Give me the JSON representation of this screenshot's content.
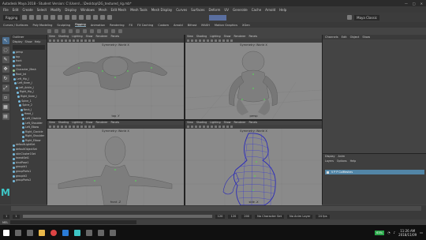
{
  "window": {
    "title": "Autodesk Maya 2018 - Student Version: C:\\Users\\...\\Desktop\\DG_textured_rig.mb*"
  },
  "menubar": [
    "File",
    "Edit",
    "Create",
    "Select",
    "Modify",
    "Display",
    "Windows",
    "Mesh",
    "Edit Mesh",
    "Mesh Tools",
    "Mesh Display",
    "Curves",
    "Surfaces",
    "Deform",
    "UV",
    "Generate",
    "Cache",
    "Arnold",
    "Help"
  ],
  "shelf": {
    "mode": "Rigging",
    "workspace": "Maya Classic"
  },
  "shelf_tabs": [
    "Curves / Surfaces",
    "Poly Modeling",
    "Sculpting",
    "Rigging",
    "Animation",
    "Rendering",
    "FX",
    "FX Caching",
    "Custom",
    "Arnold",
    "Bifrost",
    "MASH",
    "Motion Graphics",
    "XGen"
  ],
  "shelf_tabs_active": "Rigging",
  "outliner": {
    "header": "Outliner",
    "menu": [
      "Display",
      "Show",
      "Help"
    ],
    "items": [
      {
        "label": "persp",
        "type": "cam"
      },
      {
        "label": "top",
        "type": "cam"
      },
      {
        "label": "front",
        "type": "cam"
      },
      {
        "label": "side",
        "type": "cam"
      },
      {
        "label": "Character_Mesh",
        "type": "mesh"
      },
      {
        "label": "Root_Jnt",
        "type": "jnt"
      },
      {
        "label": "Left_Hip_J",
        "type": "jnt"
      },
      {
        "label": "Left_Knee_J",
        "type": "jnt"
      },
      {
        "label": "Left_Ankle_J",
        "type": "jnt"
      },
      {
        "label": "Right_Hip_J",
        "type": "jnt"
      },
      {
        "label": "Right_Knee_J",
        "type": "jnt"
      },
      {
        "label": "Spine_1",
        "type": "jnt"
      },
      {
        "label": "Spine_2",
        "type": "jnt"
      },
      {
        "label": "Neck_J",
        "type": "jnt"
      },
      {
        "label": "Head_J",
        "type": "jnt"
      },
      {
        "label": "Left_Clavicle",
        "type": "jnt"
      },
      {
        "label": "Left_Shoulder",
        "type": "jnt"
      },
      {
        "label": "Left_Elbow",
        "type": "jnt"
      },
      {
        "label": "Right_Clavicle",
        "type": "jnt"
      },
      {
        "label": "Right_Shoulder",
        "type": "jnt"
      },
      {
        "label": "Right_Elbow",
        "type": "jnt"
      },
      {
        "label": "defaultLightSet",
        "type": "set"
      },
      {
        "label": "defaultObjectSet",
        "type": "set"
      },
      {
        "label": "skinCluster1Set",
        "type": "set"
      },
      {
        "label": "tweakSet1",
        "type": "set"
      },
      {
        "label": "bindPose1",
        "type": "set"
      },
      {
        "label": "groupId1",
        "type": "set"
      },
      {
        "label": "groupParts1",
        "type": "set"
      },
      {
        "label": "groupId2",
        "type": "set"
      },
      {
        "label": "groupParts2",
        "type": "set"
      }
    ]
  },
  "pane_menu": [
    "View",
    "Shading",
    "Lighting",
    "Show",
    "Renderer",
    "Panels"
  ],
  "panes": [
    {
      "title": "Symmetry: World X",
      "camera": "top -Y"
    },
    {
      "title": "Symmetry: World X",
      "camera": "persp"
    },
    {
      "title": "Symmetry: World X",
      "camera": "front -Z"
    },
    {
      "title": "Symmetry: World X",
      "camera": "side -X"
    }
  ],
  "right_panel": {
    "tabs": [
      "Channels",
      "Edit",
      "Object",
      "Show"
    ],
    "layer_tabs": [
      "Display",
      "Anim"
    ],
    "layer_menu": [
      "Layers",
      "Options",
      "Help"
    ],
    "layer_name": "V P  P  ColMeshes"
  },
  "range": {
    "start": "1",
    "start2": "1",
    "end": "120",
    "end2": "120",
    "end3": "200",
    "char_set": "No Character Set",
    "anim_layer": "No Anim Layer",
    "fps": "24 fps"
  },
  "mel": {
    "label": "MEL"
  },
  "taskbar": {
    "time": "11:26 AM",
    "date": "2018/11/09",
    "badge": "63%"
  }
}
